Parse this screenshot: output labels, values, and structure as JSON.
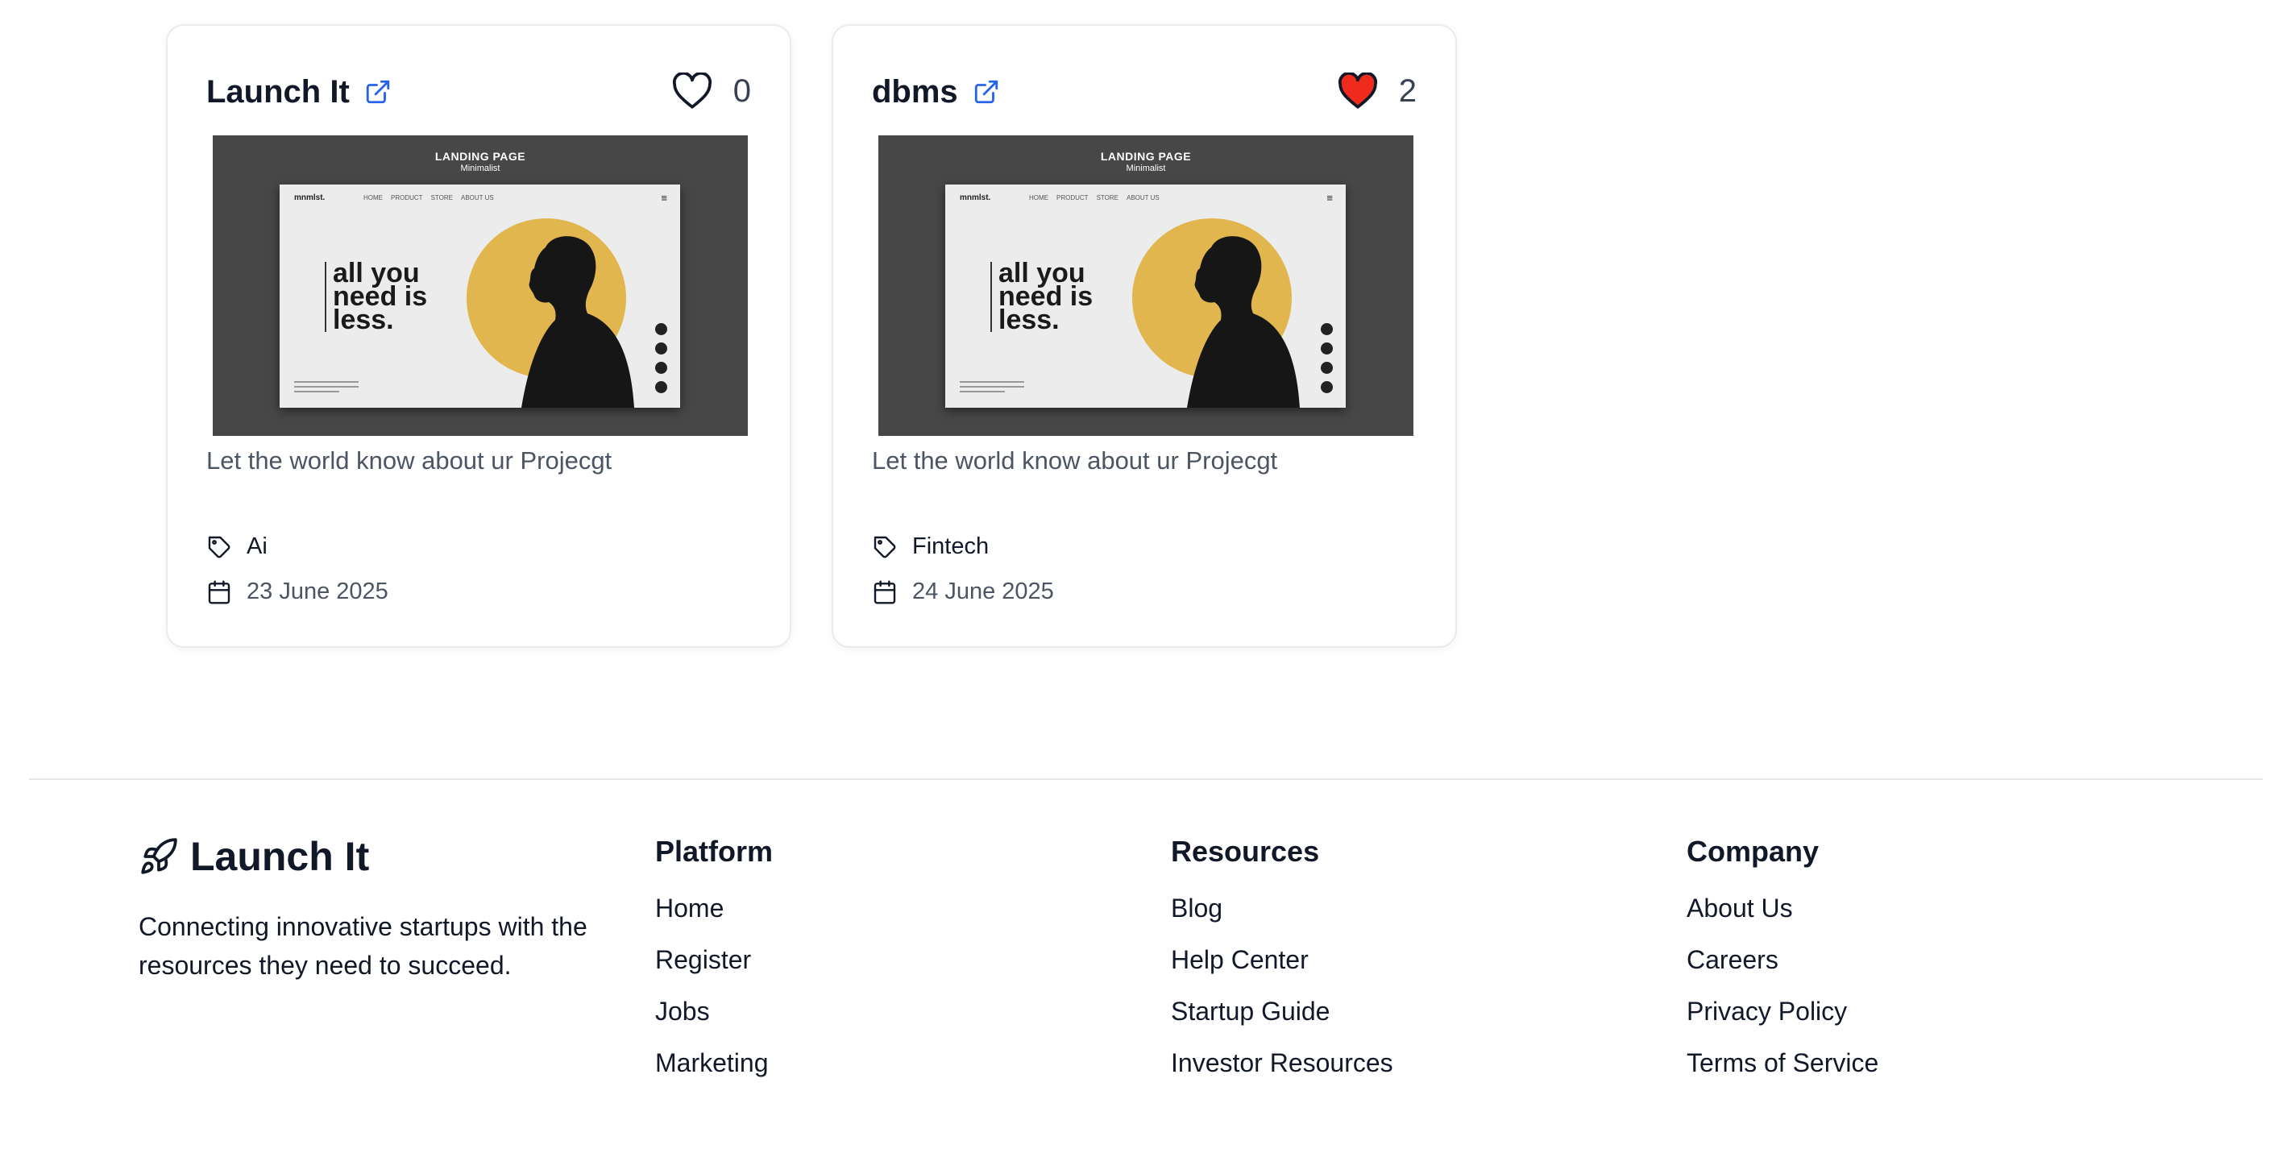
{
  "cards": [
    {
      "title": "Launch It",
      "likes": "0",
      "liked": false,
      "description": "Let the world know about ur Projecgt",
      "tag": "Ai",
      "date": "23 June 2025",
      "preview": {
        "title": "LANDING PAGE",
        "subtitle": "Minimalist",
        "logo": "mnmlst.",
        "nav": [
          "HOME",
          "PRODUCT",
          "STORE",
          "ABOUT US"
        ],
        "headline": [
          "all you",
          "need is",
          "less."
        ]
      }
    },
    {
      "title": "dbms",
      "likes": "2",
      "liked": true,
      "description": "Let the world know about ur Projecgt",
      "tag": "Fintech",
      "date": "24 June 2025",
      "preview": {
        "title": "LANDING PAGE",
        "subtitle": "Minimalist",
        "logo": "mnmlst.",
        "nav": [
          "HOME",
          "PRODUCT",
          "STORE",
          "ABOUT US"
        ],
        "headline": [
          "all you",
          "need is",
          "less."
        ]
      }
    }
  ],
  "footer": {
    "brand": "Launch It",
    "tagline": "Connecting innovative startups with the resources they need to succeed.",
    "columns": [
      {
        "title": "Platform",
        "links": [
          "Home",
          "Register",
          "Jobs",
          "Marketing"
        ]
      },
      {
        "title": "Resources",
        "links": [
          "Blog",
          "Help Center",
          "Startup Guide",
          "Investor Resources"
        ]
      },
      {
        "title": "Company",
        "links": [
          "About Us",
          "Careers",
          "Privacy Policy",
          "Terms of Service"
        ]
      }
    ]
  },
  "colors": {
    "link_icon": "#2563eb",
    "heart_liked": "#ef2b1d",
    "preview_accent": "#e2b64f"
  },
  "icons": [
    "external-link-icon",
    "heart-icon",
    "tag-icon",
    "calendar-icon",
    "rocket-icon"
  ]
}
